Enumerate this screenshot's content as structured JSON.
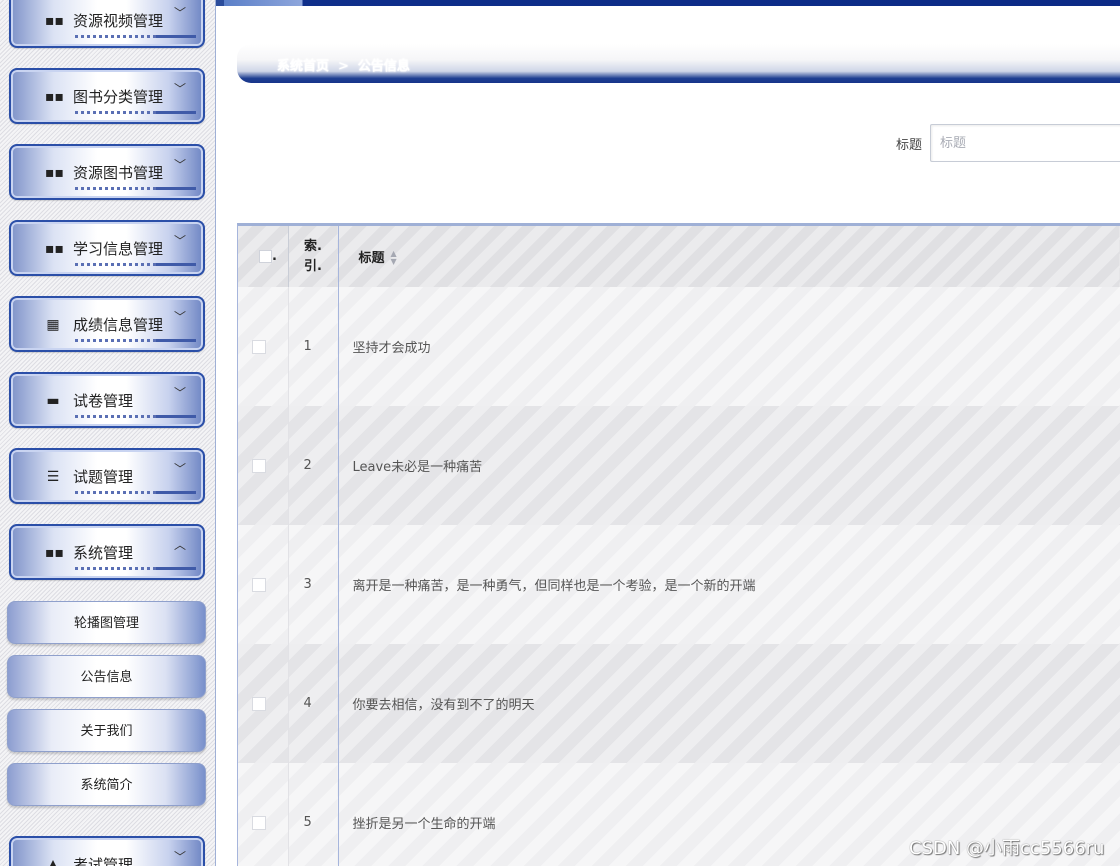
{
  "sidebar": {
    "groups": [
      {
        "label": "资源视频管理",
        "icon": "video-icon",
        "glyph": "▪▪",
        "expanded": false
      },
      {
        "label": "图书分类管理",
        "icon": "grid-icon",
        "glyph": "▪▪",
        "expanded": false
      },
      {
        "label": "资源图书管理",
        "icon": "grid-icon",
        "glyph": "▪▪",
        "expanded": false
      },
      {
        "label": "学习信息管理",
        "icon": "grid-icon",
        "glyph": "▪▪",
        "expanded": false
      },
      {
        "label": "成绩信息管理",
        "icon": "grid-9-icon",
        "glyph": "▦",
        "expanded": false
      },
      {
        "label": "试卷管理",
        "icon": "monitor-icon",
        "glyph": "▬",
        "expanded": false
      },
      {
        "label": "试题管理",
        "icon": "sliders-icon",
        "glyph": "☰",
        "expanded": false
      },
      {
        "label": "系统管理",
        "icon": "grid-icon",
        "glyph": "▪▪",
        "expanded": true
      },
      {
        "label": "考试管理",
        "icon": "exam-icon",
        "glyph": "▲",
        "expanded": false
      }
    ],
    "chevron_down": "﹀",
    "chevron_up": "︿",
    "sub_items": [
      "轮播图管理",
      "公告信息",
      "关于我们",
      "系统简介"
    ]
  },
  "breadcrumb": {
    "home": "系统首页",
    "separator": ">",
    "current": "公告信息"
  },
  "search": {
    "label": "标题",
    "placeholder": "标题"
  },
  "table": {
    "header_check_suffix": ".",
    "columns": {
      "index": "索.\n引.",
      "title": "标题"
    },
    "rows": [
      {
        "index": "1",
        "title": "坚持才会成功"
      },
      {
        "index": "2",
        "title": "Leave未必是一种痛苦"
      },
      {
        "index": "3",
        "title": "离开是一种痛苦，是一种勇气，但同样也是一个考验，是一个新的开端"
      },
      {
        "index": "4",
        "title": "你要去相信，没有到不了的明天"
      },
      {
        "index": "5",
        "title": "挫折是另一个生命的开端"
      }
    ]
  },
  "watermark": "CSDN @小雨cc5566ru",
  "colors": {
    "accent": "#2b4fa8",
    "header_dark": "#17348a"
  }
}
